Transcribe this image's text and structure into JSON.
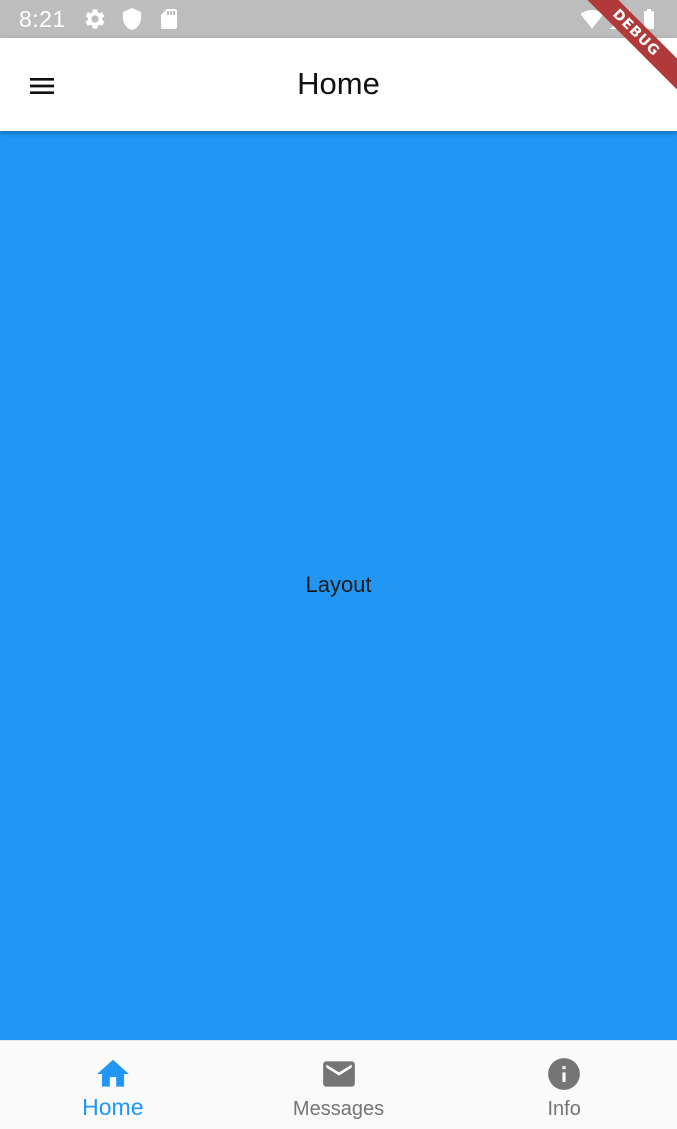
{
  "status_bar": {
    "time": "8:21",
    "icons": [
      "settings-icon",
      "shield-icon",
      "sd-card-icon",
      "wifi-icon",
      "signal-icon",
      "battery-icon"
    ]
  },
  "debug_banner": {
    "label": "DEBUG"
  },
  "app_bar": {
    "title": "Home",
    "menu_icon": "menu-icon"
  },
  "content": {
    "text": "Layout",
    "background": "#2196f3"
  },
  "bottom_nav": {
    "active_color": "#2196f3",
    "inactive_color": "#757575",
    "items": [
      {
        "label": "Home",
        "icon": "home-icon",
        "active": true
      },
      {
        "label": "Messages",
        "icon": "mail-icon",
        "active": false
      },
      {
        "label": "Info",
        "icon": "info-icon",
        "active": false
      }
    ]
  }
}
